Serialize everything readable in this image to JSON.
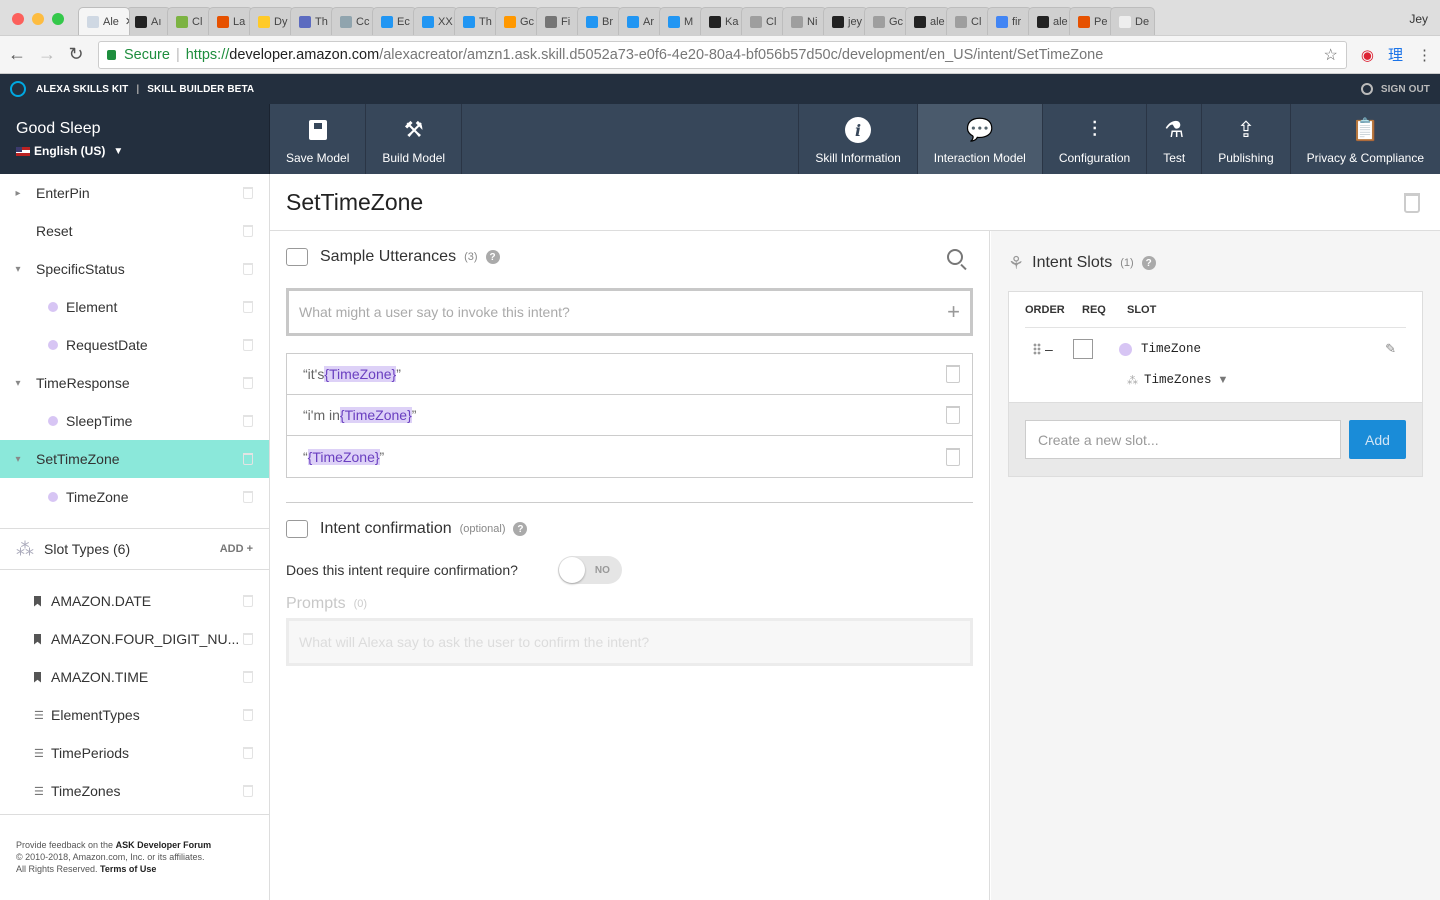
{
  "browser": {
    "tabs": [
      {
        "label": "Ale",
        "color": "#cfd8e3",
        "active": true
      },
      {
        "label": "Aı",
        "color": "#222222"
      },
      {
        "label": "Cl",
        "color": "#7cb342"
      },
      {
        "label": "La",
        "color": "#e65100"
      },
      {
        "label": "Dy",
        "color": "#ffca28"
      },
      {
        "label": "Th",
        "color": "#5c6bc0"
      },
      {
        "label": "Cc",
        "color": "#90a4ae"
      },
      {
        "label": "Ec",
        "color": "#2196f3"
      },
      {
        "label": "XX",
        "color": "#2196f3"
      },
      {
        "label": "Th",
        "color": "#2196f3"
      },
      {
        "label": "Gc",
        "color": "#ff9800"
      },
      {
        "label": "Fi",
        "color": "#757575"
      },
      {
        "label": "Br",
        "color": "#2196f3"
      },
      {
        "label": "Ar",
        "color": "#2196f3"
      },
      {
        "label": "M",
        "color": "#2196f3"
      },
      {
        "label": "Ka",
        "color": "#222222"
      },
      {
        "label": "Cl",
        "color": "#9e9e9e"
      },
      {
        "label": "Ni",
        "color": "#9e9e9e"
      },
      {
        "label": "jey",
        "color": "#222222"
      },
      {
        "label": "Gc",
        "color": "#9e9e9e"
      },
      {
        "label": "ale",
        "color": "#222222"
      },
      {
        "label": "Cl",
        "color": "#9e9e9e"
      },
      {
        "label": "fir",
        "color": "#4285f4"
      },
      {
        "label": "ale",
        "color": "#222222"
      },
      {
        "label": "Pe",
        "color": "#e65100"
      },
      {
        "label": "De",
        "color": "#eeeeee"
      }
    ],
    "user": "Jey",
    "secure_label": "Secure",
    "url_scheme": "https://",
    "url_host": "developer.amazon.com",
    "url_path": "/alexacreator/amzn1.ask.skill.d5052a73-e0f6-4e20-80a4-bf056b57d50c/development/en_US/intent/SetTimeZone",
    "ext_label": "理"
  },
  "ask_bar": {
    "brand": "ALEXA SKILLS KIT",
    "sep": "|",
    "product": "SKILL BUILDER BETA",
    "signout": "SIGN OUT"
  },
  "skill": {
    "name": "Good Sleep",
    "locale": "English (US)"
  },
  "toolbar": {
    "save": "Save Model",
    "build": "Build Model",
    "info": "Skill Information",
    "interaction": "Interaction Model",
    "config": "Configuration",
    "test": "Test",
    "publishing": "Publishing",
    "privacy": "Privacy & Compliance"
  },
  "sidebar": {
    "intents": [
      {
        "label": "EnterPin",
        "caret": "▸",
        "type": "intent"
      },
      {
        "label": "Reset",
        "caret": "",
        "type": "intent"
      },
      {
        "label": "SpecificStatus",
        "caret": "▾",
        "type": "intent"
      },
      {
        "label": "Element",
        "type": "slot"
      },
      {
        "label": "RequestDate",
        "type": "slot"
      },
      {
        "label": "TimeResponse",
        "caret": "▾",
        "type": "intent"
      },
      {
        "label": "SleepTime",
        "type": "slot"
      },
      {
        "label": "SetTimeZone",
        "caret": "▾",
        "type": "intent",
        "active": true
      },
      {
        "label": "TimeZone",
        "type": "slot"
      }
    ],
    "slot_types_label": "Slot Types (6)",
    "add_label": "ADD +",
    "slot_types": [
      {
        "label": "AMAZON.DATE",
        "kind": "builtin"
      },
      {
        "label": "AMAZON.FOUR_DIGIT_NU...",
        "kind": "builtin"
      },
      {
        "label": "AMAZON.TIME",
        "kind": "builtin"
      },
      {
        "label": "ElementTypes",
        "kind": "custom"
      },
      {
        "label": "TimePeriods",
        "kind": "custom"
      },
      {
        "label": "TimeZones",
        "kind": "custom"
      }
    ],
    "footer": {
      "line1_pre": "Provide feedback on the ",
      "line1_link": "ASK Developer Forum",
      "line2": "© 2010-2018, Amazon.com, Inc. or its affiliates.",
      "line3_pre": "All Rights Reserved. ",
      "line3_link": "Terms of Use"
    }
  },
  "intent": {
    "title": "SetTimeZone",
    "utterances_label": "Sample Utterances",
    "utterances_count": "(3)",
    "utterance_placeholder": "What might a user say to invoke this intent?",
    "add_glyph": "+",
    "utterances": [
      {
        "pre": "“it's ",
        "slot": "{TimeZone}",
        "post": "”"
      },
      {
        "pre": "“i'm in ",
        "slot": "{TimeZone}",
        "post": "”"
      },
      {
        "pre": "“",
        "slot": "{TimeZone}",
        "post": "”"
      }
    ],
    "confirmation_label": "Intent confirmation",
    "optional_label": "(optional)",
    "confirmation_question": "Does this intent require confirmation?",
    "toggle_label": "NO",
    "prompts_label": "Prompts",
    "prompts_count": "(0)",
    "prompt_placeholder": "What will Alexa say to ask the user to confirm the intent?",
    "help_glyph": "?"
  },
  "slots": {
    "title": "Intent Slots",
    "count": "(1)",
    "headers": {
      "order": "ORDER",
      "req": "REQ",
      "slot": "SLOT"
    },
    "rows": [
      {
        "name": "TimeZone",
        "type": "TimeZones",
        "dash": "–"
      }
    ],
    "create_placeholder": "Create a new slot...",
    "add_button": "Add"
  }
}
